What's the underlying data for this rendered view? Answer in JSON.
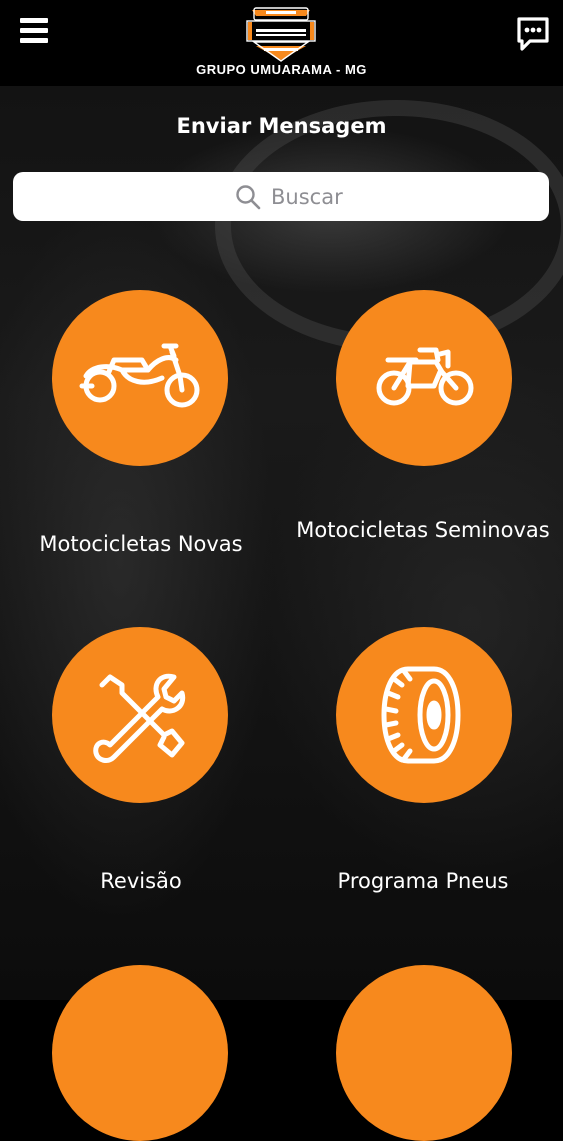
{
  "header": {
    "menu_icon": "hamburger-menu-icon",
    "chat_icon": "chat-bubble-icon",
    "logo_icon": "harley-davidson-shield-logo",
    "dealer_name": "GRUPO UMUARAMA - MG"
  },
  "contact": {
    "label": "Enviar Mensagem"
  },
  "search": {
    "placeholder": "Buscar",
    "icon": "search-icon"
  },
  "menu": {
    "items": [
      {
        "label": "Motocicletas Novas",
        "icon": "cruiser-motorcycle-icon"
      },
      {
        "label": "Motocicletas Seminovas",
        "icon": "used-motorcycle-icon"
      },
      {
        "label": "Revisão",
        "icon": "wrench-screwdriver-icon"
      },
      {
        "label": "Programa Pneus",
        "icon": "tire-icon"
      }
    ]
  },
  "colors": {
    "accent": "#f7891d",
    "background": "#000000",
    "search_bg": "#ffffff"
  }
}
